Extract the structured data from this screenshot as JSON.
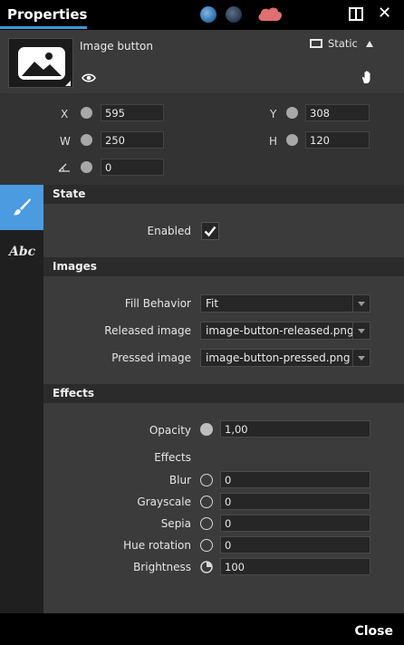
{
  "titlebar": {
    "title": "Properties",
    "icons": [
      "globe-app-icon",
      "globe-icon",
      "cloud-icon",
      "layout-icon",
      "close-icon"
    ]
  },
  "widget": {
    "name": "Image button",
    "visibility_icon": "eye-icon",
    "mode_label": "Static",
    "hand_icon": "hand-icon"
  },
  "geometry": {
    "x_label": "X",
    "x_value": "595",
    "y_label": "Y",
    "y_value": "308",
    "w_label": "W",
    "w_value": "250",
    "h_label": "H",
    "h_value": "120",
    "angle_value": "0"
  },
  "tabs": [
    {
      "name": "state",
      "icon": "brush-icon",
      "active": true
    },
    {
      "name": "text",
      "label": "Abc",
      "active": false
    }
  ],
  "sections": {
    "state": {
      "title": "State",
      "enabled_label": "Enabled",
      "enabled_checked": true
    },
    "images": {
      "title": "Images",
      "fill_label": "Fill Behavior",
      "fill_value": "Fit",
      "released_label": "Released image",
      "released_value": "image-button-released.png",
      "pressed_label": "Pressed image",
      "pressed_value": "image-button-pressed.png"
    },
    "effects": {
      "title": "Effects",
      "opacity_label": "Opacity",
      "opacity_value": "1,00",
      "effects_label": "Effects",
      "items": [
        {
          "label": "Blur",
          "value": "0"
        },
        {
          "label": "Grayscale",
          "value": "0"
        },
        {
          "label": "Sepia",
          "value": "0"
        },
        {
          "label": "Hue rotation",
          "value": "0"
        },
        {
          "label": "Brightness",
          "value": "100"
        }
      ]
    }
  },
  "footer": {
    "close_label": "Close"
  },
  "colors": {
    "accent": "#4a9be0",
    "cloud": "#e07070"
  }
}
